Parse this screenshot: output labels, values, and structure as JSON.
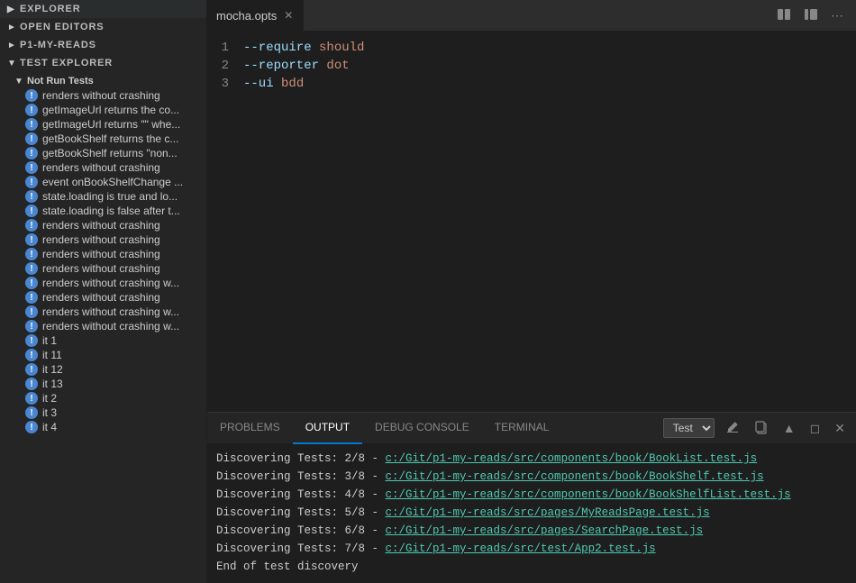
{
  "sidebar": {
    "explorer_label": "EXPLORER",
    "sections": [
      {
        "id": "open-editors",
        "label": "OPEN EDITORS",
        "collapsed": true
      },
      {
        "id": "p1-my-reads",
        "label": "P1-MY-READS",
        "collapsed": true
      },
      {
        "id": "test-explorer",
        "label": "TEST EXPLORER",
        "collapsed": false
      }
    ],
    "test_subsection": "Not Run Tests",
    "test_items": [
      "renders without crashing",
      "getImageUrl returns the co...",
      "getImageUrl returns \"\" whe...",
      "getBookShelf returns the c...",
      "getBookShelf returns \"non...",
      "renders without crashing",
      "event onBookShelfChange ...",
      "state.loading is true and lo...",
      "state.loading is false after t...",
      "renders without crashing",
      "renders without crashing",
      "renders without crashing",
      "renders without crashing",
      "renders without crashing w...",
      "renders without crashing",
      "renders without crashing w...",
      "renders without crashing w...",
      "it 1",
      "it 11",
      "it 12",
      "it 13",
      "it 2",
      "it 3",
      "it 4"
    ]
  },
  "editor": {
    "tab_label": "mocha.opts",
    "lines": [
      {
        "num": 1,
        "flag": "--require",
        "value": "should"
      },
      {
        "num": 2,
        "flag": "--reporter",
        "value": "dot"
      },
      {
        "num": 3,
        "flag": "--ui",
        "value": "bdd"
      }
    ]
  },
  "panel": {
    "tabs": [
      "PROBLEMS",
      "OUTPUT",
      "DEBUG CONSOLE",
      "TERMINAL"
    ],
    "active_tab": "OUTPUT",
    "dropdown_label": "Test",
    "output_lines": [
      {
        "plain": "Discovering Tests: 2/8 - ",
        "link": "c:/Git/p1-my-reads/src/components/book/BookList.test.js"
      },
      {
        "plain": "Discovering Tests: 3/8 - ",
        "link": "c:/Git/p1-my-reads/src/components/book/BookShelf.test.js"
      },
      {
        "plain": "Discovering Tests: 4/8 - ",
        "link": "c:/Git/p1-my-reads/src/components/book/BookShelfList.test.js"
      },
      {
        "plain": "Discovering Tests: 5/8 - ",
        "link": "c:/Git/p1-my-reads/src/pages/MyReadsPage.test.js"
      },
      {
        "plain": "Discovering Tests: 6/8 - ",
        "link": "c:/Git/p1-my-reads/src/pages/SearchPage.test.js"
      },
      {
        "plain": "Discovering Tests: 7/8 - ",
        "link": "c:/Git/p1-my-reads/src/test/App2.test.js"
      },
      {
        "plain": "End of test discovery",
        "link": ""
      }
    ]
  }
}
